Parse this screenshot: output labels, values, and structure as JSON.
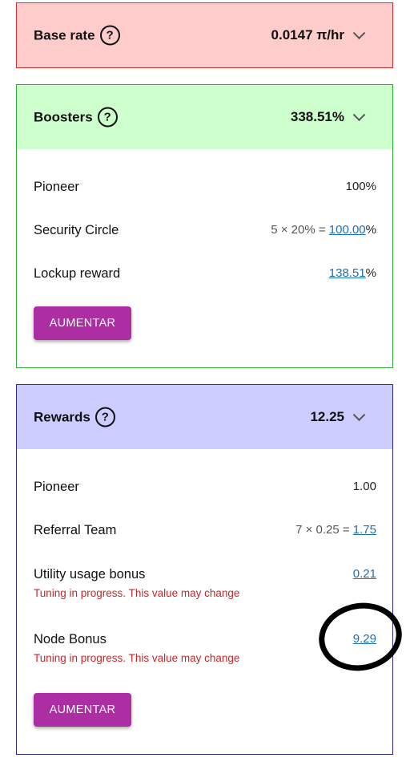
{
  "base_rate": {
    "title": "Base rate",
    "help_icon": "question-circle-icon",
    "value": "0.0147 π/hr",
    "header_color": "#ffcccc",
    "border_color": "#cc3333"
  },
  "boosters": {
    "title": "Boosters",
    "help_icon": "question-circle-icon",
    "value": "338.51%",
    "header_color": "#ccffcc",
    "border_color": "#33aa33",
    "items": [
      {
        "label": "Pioneer",
        "value": "100%"
      },
      {
        "label": "Security Circle",
        "formula": "5 × 20% = ",
        "link": "100.00",
        "suffix": "%"
      },
      {
        "label": "Lockup reward",
        "link": "138.51",
        "suffix": "%"
      }
    ],
    "button_label": "AUMENTAR"
  },
  "rewards": {
    "title": "Rewards",
    "help_icon": "question-circle-icon",
    "value": "12.25",
    "header_color": "#ccccff",
    "border_color": "#2a2a8a",
    "items": [
      {
        "label": "Pioneer",
        "value": "1.00"
      },
      {
        "label": "Referral Team",
        "formula": "7 × 0.25 = ",
        "link": "1.75"
      },
      {
        "label": "Utility usage bonus",
        "link": "0.21",
        "warning": "Tuning in progress. This value may change"
      },
      {
        "label": "Node Bonus",
        "link": "9.29",
        "warning": "Tuning in progress. This value may change"
      }
    ],
    "button_label": "AUMENTAR"
  },
  "accent_color": "#ad2ea2",
  "link_color": "#1b6fb5",
  "warning_color": "#c62828"
}
